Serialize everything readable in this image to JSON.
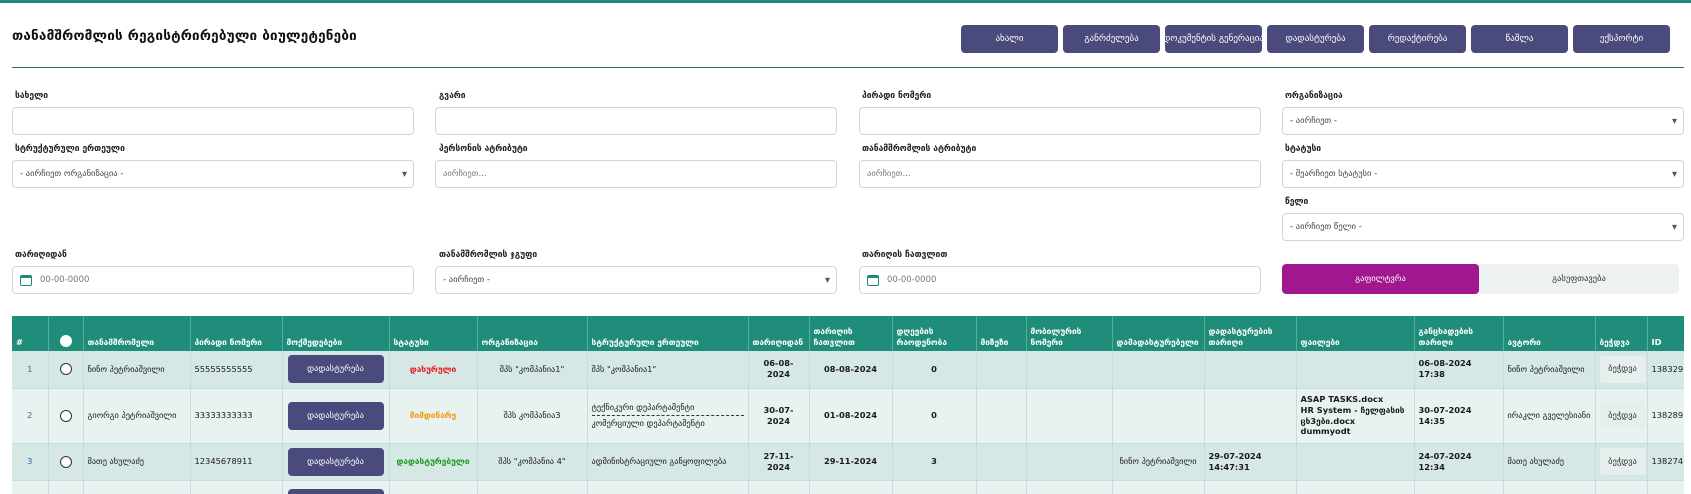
{
  "page_title": "თანამშრომლის რეგისტრირებული ბიულეტენები",
  "toolbar": [
    {
      "label": "ახალი",
      "name": "new-button"
    },
    {
      "label": "განრძელება",
      "name": "extend-button"
    },
    {
      "label": "დოკუმენტის გენერაცია",
      "name": "generate-document-button"
    },
    {
      "label": "დადასტურება",
      "name": "confirm-button"
    },
    {
      "label": "რედაქტირება",
      "name": "edit-button"
    },
    {
      "label": "წაშლა",
      "name": "delete-button"
    },
    {
      "label": "ექსპორტი",
      "name": "export-button"
    }
  ],
  "filters": {
    "name": {
      "label": "სახელი",
      "value": ""
    },
    "surname": {
      "label": "გვარი",
      "value": ""
    },
    "personal_number": {
      "label": "პირადი ნომერი",
      "value": ""
    },
    "organization": {
      "label": "ორგანიზაცია",
      "value": "- აირჩიეთ -"
    },
    "structural_unit": {
      "label": "სტრუქტურული ერთეული",
      "value": "- აირჩიეთ ორგანიზაცია -"
    },
    "person_attribute": {
      "label": "პერსონის ატრიბუტი",
      "placeholder": "აირჩიეთ..."
    },
    "employee_attribute": {
      "label": "თანამშრომლის ატრიბუტი",
      "placeholder": "აირჩიეთ..."
    },
    "status": {
      "label": "სტატუსი",
      "value": "- შეარჩიეთ სტატუსი -"
    },
    "year": {
      "label": "წელი",
      "value": "- აირჩიეთ წელი -"
    },
    "date_from": {
      "label": "თარიღიდან",
      "placeholder": "00-00-0000"
    },
    "employee_group": {
      "label": "თანამშრომლის ჯგუფი",
      "value": "- აირჩიეთ -"
    },
    "date_to": {
      "label": "თარიღის ჩათვლით",
      "placeholder": "00-00-0000"
    }
  },
  "toggle": {
    "filter_label": "გაფილტვრა",
    "clear_label": "გასუფთავება"
  },
  "table": {
    "headers": {
      "index": "#",
      "employee": "თანამშრომელი",
      "personal_number": "პირადი ნომერი",
      "actions": "მოქმედებები",
      "status": "სტატუსი",
      "organization": "ორგანიზაცია",
      "structural_unit": "სტრუქტურული ერთეული",
      "date_from": "თარიღიდან",
      "date_to": "თარიღის ჩათვლით",
      "days_count": "დღეების რაოდენობა",
      "reason": "მიზეზი",
      "bulletin_number": "მობილურის ნომერი",
      "confirmer": "დამადასტურებელი",
      "confirm_date": "დადასტურების თარიღი",
      "files": "ფაილები",
      "placement_date": "განცხადების თარიღი",
      "author": "ავტორი",
      "print": "ბეჭდვა",
      "id": "ID"
    },
    "rows": [
      {
        "index": "1",
        "employee": "ნინო პეტრიაშვილი",
        "personal_number": "55555555555",
        "action": "დადასტურება",
        "status": "დახურული",
        "status_color": "#e41b1b",
        "organization": "შპს \"კომპანია1\"",
        "structural_unit": [
          "შპს \"კომპანია1\""
        ],
        "date_from": "06-08-2024",
        "date_to": "08-08-2024",
        "days_count": "0",
        "reason": "",
        "bulletin_number": "",
        "confirmer": "",
        "confirm_date": "",
        "files": [],
        "placement_date": "06-08-2024 17:38",
        "author": "ნინო პეტრიაშვილი",
        "print": "ბეჭდვა",
        "id": "138329"
      },
      {
        "index": "2",
        "employee": "გიორგი პეტრიაშვილი",
        "personal_number": "33333333333",
        "action": "დადასტურება",
        "status": "მიმდინარე",
        "status_color": "#f29a00",
        "organization": "შპს კომპანია3",
        "structural_unit": [
          "ტექნიკური დეპარტამენტი",
          "კომერციული დეპარტამენტი"
        ],
        "date_from": "30-07-2024",
        "date_to": "01-08-2024",
        "days_count": "0",
        "reason": "",
        "bulletin_number": "",
        "confirmer": "",
        "confirm_date": "",
        "files": [
          "ASAP TASKS.docx",
          "HR System - ჩელფასის ცხ3ები.docx",
          "dummyodt"
        ],
        "placement_date": "30-07-2024 14:35",
        "author": "ირაკლი გველესიანი",
        "print": "ბეჭდვა",
        "id": "138289"
      },
      {
        "index": "3",
        "employee": "მათე ახულაძე",
        "personal_number": "12345678911",
        "action": "დადასტურება",
        "status": "დადასტურებული",
        "status_color": "#1a9a1a",
        "organization": "შპს \"კომპანია 4\"",
        "structural_unit": [
          "ადმინისტრაციული განყოფილება"
        ],
        "date_from": "27-11-2024",
        "date_to": "29-11-2024",
        "days_count": "3",
        "reason": "",
        "bulletin_number": "",
        "confirmer": "ნინო პეტრიაშვილი",
        "confirm_date": "29-07-2024 14:47:31",
        "files": [],
        "placement_date": "24-07-2024 12:34",
        "author": "მათე ახულაძე",
        "print": "ბეჭდვა",
        "id": "138274"
      },
      {
        "index": "",
        "employee": "",
        "personal_number": "",
        "action": "",
        "status": "",
        "status_color": "#1a1a1a",
        "organization": "",
        "structural_unit": [],
        "date_from": "",
        "date_to": "",
        "days_count": "",
        "reason": "",
        "bulletin_number": "",
        "confirmer": "",
        "confirm_date": "",
        "files": [],
        "placement_date": "",
        "author": "",
        "print": "",
        "id": ""
      }
    ]
  },
  "colors": {
    "primary_button": "#4a4a7c",
    "table_header": "#1f8d7a",
    "filter_active": "#a0178e",
    "status_closed": "#e41b1b",
    "status_ongoing": "#f29a00",
    "status_confirmed": "#1a9a1a"
  },
  "icons": {
    "date_field": "calendar-icon",
    "select_arrow": "chevron-down-icon",
    "row_select": "radio-icon"
  }
}
